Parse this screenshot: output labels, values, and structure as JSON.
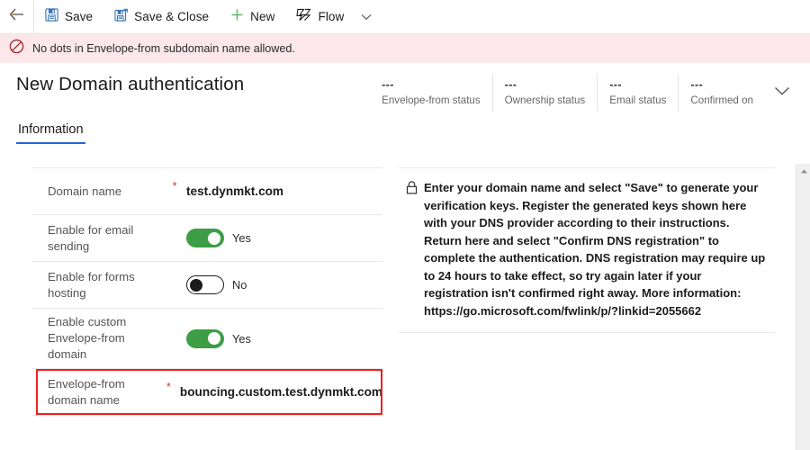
{
  "commandbar": {
    "back_icon": "back-arrow-icon",
    "items": [
      {
        "label": "Save",
        "icon": "save-disk-icon"
      },
      {
        "label": "Save & Close",
        "icon": "save-and-close-disk-icon"
      },
      {
        "label": "New",
        "icon": "plus-icon"
      },
      {
        "label": "Flow",
        "icon": "flow-icon"
      }
    ],
    "overflow_icon": "chevron-down-icon"
  },
  "notification": {
    "icon": "block-error-icon",
    "message": "No dots in Envelope-from subdomain name allowed.",
    "background": "#fce8ea"
  },
  "header": {
    "title": "New Domain authentication",
    "expand_icon": "chevron-down-icon",
    "status_fields": [
      {
        "value": "---",
        "label": "Envelope-from status"
      },
      {
        "value": "---",
        "label": "Ownership status"
      },
      {
        "value": "---",
        "label": "Email status"
      },
      {
        "value": "---",
        "label": "Confirmed on"
      }
    ]
  },
  "tabs": [
    {
      "label": "Information",
      "active": true,
      "accent": "#2266dd"
    }
  ],
  "form": {
    "rows": [
      {
        "label": "Domain name",
        "required": "*",
        "type": "text",
        "value": "test.dynmkt.com"
      },
      {
        "label": "Enable for email sending",
        "required": "",
        "type": "toggle",
        "state": "on",
        "value": "Yes"
      },
      {
        "label": "Enable for forms hosting",
        "required": "",
        "type": "toggle",
        "state": "off",
        "value": "No"
      },
      {
        "label": "Enable custom Envelope-from domain",
        "required": "",
        "type": "toggle",
        "state": "on",
        "value": "Yes"
      },
      {
        "label": "Envelope-from domain name",
        "required": "*",
        "type": "text",
        "value": "bouncing.custom.test.dynmkt.com",
        "error": true
      }
    ],
    "error_border_color": "#ef2020",
    "toggle_on_color": "#3d9e46"
  },
  "help": {
    "icon": "lock-icon",
    "text": "Enter your domain name and select \"Save\" to generate your verification keys. Register the generated keys shown here with your DNS provider according to their instructions. Return here and select \"Confirm DNS registration\" to complete the authentication. DNS registration may require up to 24 hours to take effect, so try again later if your registration isn't confirmed right away. More information: https://go.microsoft.com/fwlink/p/?linkid=2055662"
  },
  "scrollbar": {
    "up_arrow_icon": "scroll-up-arrow-icon"
  }
}
